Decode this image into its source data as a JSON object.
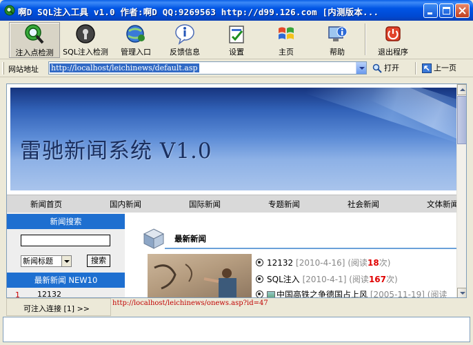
{
  "window": {
    "title": "啊D SQL注入工具 v1.0 作者:啊D QQ:9269563 http://d99.126.com [内测版本..."
  },
  "toolbar": {
    "items": [
      {
        "label": "注入点检测",
        "icon": "magnifier-globe-icon"
      },
      {
        "label": "SQL注入检测",
        "icon": "keyhole-icon"
      },
      {
        "label": "管理入口",
        "icon": "globe-ie-icon"
      },
      {
        "label": "反馈信息",
        "icon": "info-balloon-icon"
      },
      {
        "label": "设置",
        "icon": "settings-document-icon"
      },
      {
        "label": "主页",
        "icon": "windows-flag-icon"
      },
      {
        "label": "帮助",
        "icon": "help-monitor-icon"
      },
      {
        "label": "退出程序",
        "icon": "power-icon"
      }
    ]
  },
  "address": {
    "label": "网站地址",
    "value": "http://localhost/leichinews/default.asp",
    "open_label": "打开",
    "back_label": "上一页"
  },
  "page": {
    "banner_title": "雷驰新闻系统 V1.0",
    "nav": [
      "新闻首页",
      "国内新闻",
      "国际新闻",
      "专题新闻",
      "社会新闻",
      "文体新闻"
    ],
    "sidebar": {
      "search_title": "新闻搜索",
      "search_value": "",
      "select_value": "新闻标题",
      "search_button": "搜索",
      "latest_title": "最新新闻 NEW10",
      "latest_items": [
        {
          "num": "1",
          "title": "12132"
        }
      ]
    },
    "main": {
      "section_title": "最新新闻",
      "news": [
        {
          "title": "12132",
          "date": "[2010-4-16]",
          "read_prefix": "(阅读",
          "count": "18",
          "read_suffix": "次)"
        },
        {
          "title": "SQL注入",
          "date": "[2010-4-1]",
          "read_prefix": "(阅读",
          "count": "167",
          "read_suffix": "次)"
        },
        {
          "title": "中国高铁之争德国占上风",
          "date": "[2005-11-19]",
          "read_prefix": "(阅读",
          "count": "",
          "read_suffix": ""
        }
      ]
    }
  },
  "bottom": {
    "injectable_label": "可注入连接 [1] >>",
    "injectable_url": "http://localhost/leichinews/onews.asp?id=47"
  },
  "colors": {
    "title_bar": "#0055e5",
    "sidebar_header": "#1e6fd0",
    "read_count": "#e00000",
    "inject_url": "#c00000"
  }
}
